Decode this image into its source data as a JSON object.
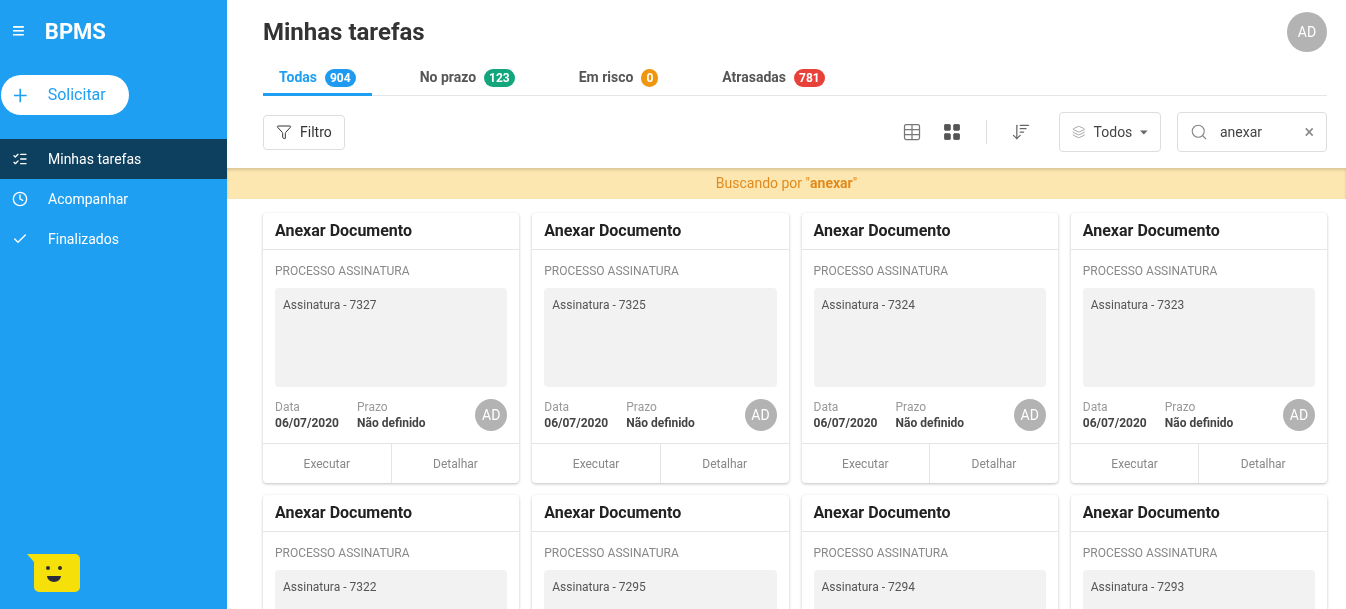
{
  "sidebar": {
    "brand": "BPMS",
    "menu_icon": "≡",
    "request_button": {
      "icon": "+",
      "label": "Solicitar"
    },
    "items": [
      {
        "kind": "tasks",
        "label": "Minhas tarefas",
        "selected": true
      },
      {
        "kind": "clock",
        "label": "Acompanhar",
        "selected": false
      },
      {
        "kind": "check",
        "label": "Finalizados",
        "selected": false
      }
    ]
  },
  "header": {
    "title": "Minhas tarefas",
    "avatar": "AD"
  },
  "tabs": [
    {
      "label": "Todas",
      "count": "904",
      "color": "#1e9bf0",
      "selected": true
    },
    {
      "label": "No prazo",
      "count": "123",
      "color": "#13a57b",
      "selected": false
    },
    {
      "label": "Em risco",
      "count": "0",
      "color": "#f0960e",
      "selected": false
    },
    {
      "label": "Atrasadas",
      "count": "781",
      "color": "#e8413a",
      "selected": false
    }
  ],
  "toolbar": {
    "filter_button": "Filtro",
    "view_buttons": [
      {
        "kind": "table",
        "selected": false
      },
      {
        "kind": "grid",
        "selected": true
      }
    ],
    "type_select": "Todos",
    "search": {
      "value": "anexar",
      "clear": "×"
    }
  },
  "search_banner": "Buscando por \"**anexar**\"",
  "cards": [
    {
      "title": "Anexar Documento",
      "process": "PROCESSO ASSINATURA",
      "description": "Assinatura - 7327",
      "date_label": "Data",
      "date": "06/07/2020",
      "deadline_label": "Prazo",
      "deadline": "Não definido",
      "avatar": "AD",
      "actions": [
        "Executar",
        "Detalhar"
      ]
    },
    {
      "title": "Anexar Documento",
      "process": "PROCESSO ASSINATURA",
      "description": "Assinatura - 7325",
      "date_label": "Data",
      "date": "06/07/2020",
      "deadline_label": "Prazo",
      "deadline": "Não definido",
      "avatar": "AD",
      "actions": [
        "Executar",
        "Detalhar"
      ]
    },
    {
      "title": "Anexar Documento",
      "process": "PROCESSO ASSINATURA",
      "description": "Assinatura - 7324",
      "date_label": "Data",
      "date": "06/07/2020",
      "deadline_label": "Prazo",
      "deadline": "Não definido",
      "avatar": "AD",
      "actions": [
        "Executar",
        "Detalhar"
      ]
    },
    {
      "title": "Anexar Documento",
      "process": "PROCESSO ASSINATURA",
      "description": "Assinatura - 7323",
      "date_label": "Data",
      "date": "06/07/2020",
      "deadline_label": "Prazo",
      "deadline": "Não definido",
      "avatar": "AD",
      "actions": [
        "Executar",
        "Detalhar"
      ]
    },
    {
      "title": "Anexar Documento",
      "process": "PROCESSO ASSINATURA",
      "description": "Assinatura - 7322"
    },
    {
      "title": "Anexar Documento",
      "process": "PROCESSO ASSINATURA",
      "description": "Assinatura - 7295"
    },
    {
      "title": "Anexar Documento",
      "process": "PROCESSO ASSINATURA",
      "description": "Assinatura - 7294"
    },
    {
      "title": "Anexar Documento",
      "process": "PROCESSO ASSINATURA",
      "description": "Assinatura - 7293"
    }
  ]
}
